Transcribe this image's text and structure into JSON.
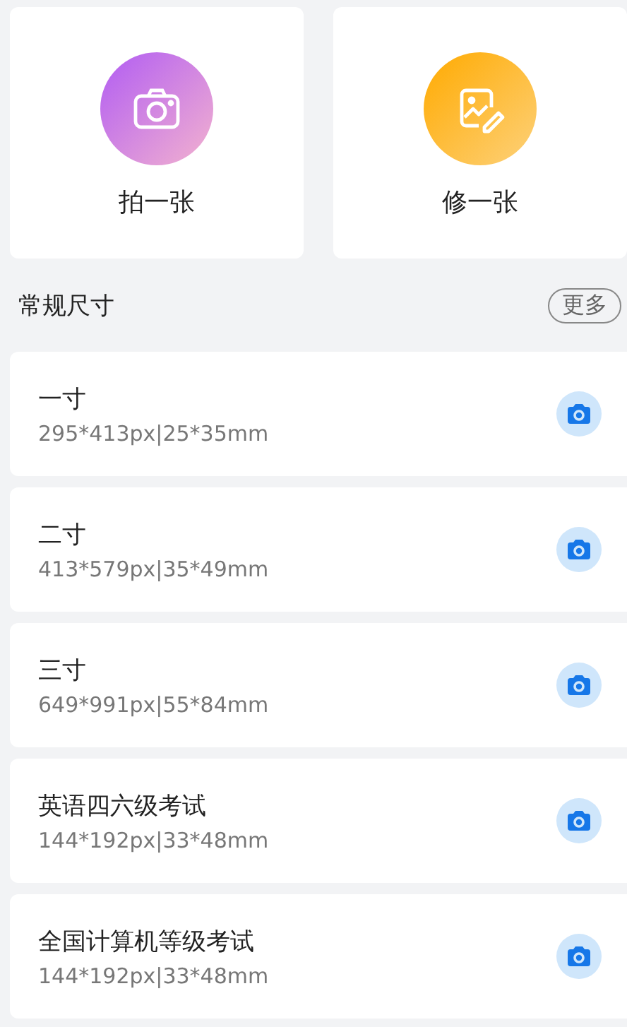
{
  "actions": [
    {
      "kind": "camera",
      "label": "拍一张"
    },
    {
      "kind": "edit",
      "label": "修一张"
    }
  ],
  "section": {
    "title": "常规尺寸",
    "more": "更多"
  },
  "sizes": [
    {
      "name": "一寸",
      "spec": "295*413px|25*35mm"
    },
    {
      "name": "二寸",
      "spec": "413*579px|35*49mm"
    },
    {
      "name": "三寸",
      "spec": "649*991px|55*84mm"
    },
    {
      "name": "英语四六级考试",
      "spec": "144*192px|33*48mm"
    },
    {
      "name": "全国计算机等级考试",
      "spec": "144*192px|33*48mm"
    }
  ]
}
